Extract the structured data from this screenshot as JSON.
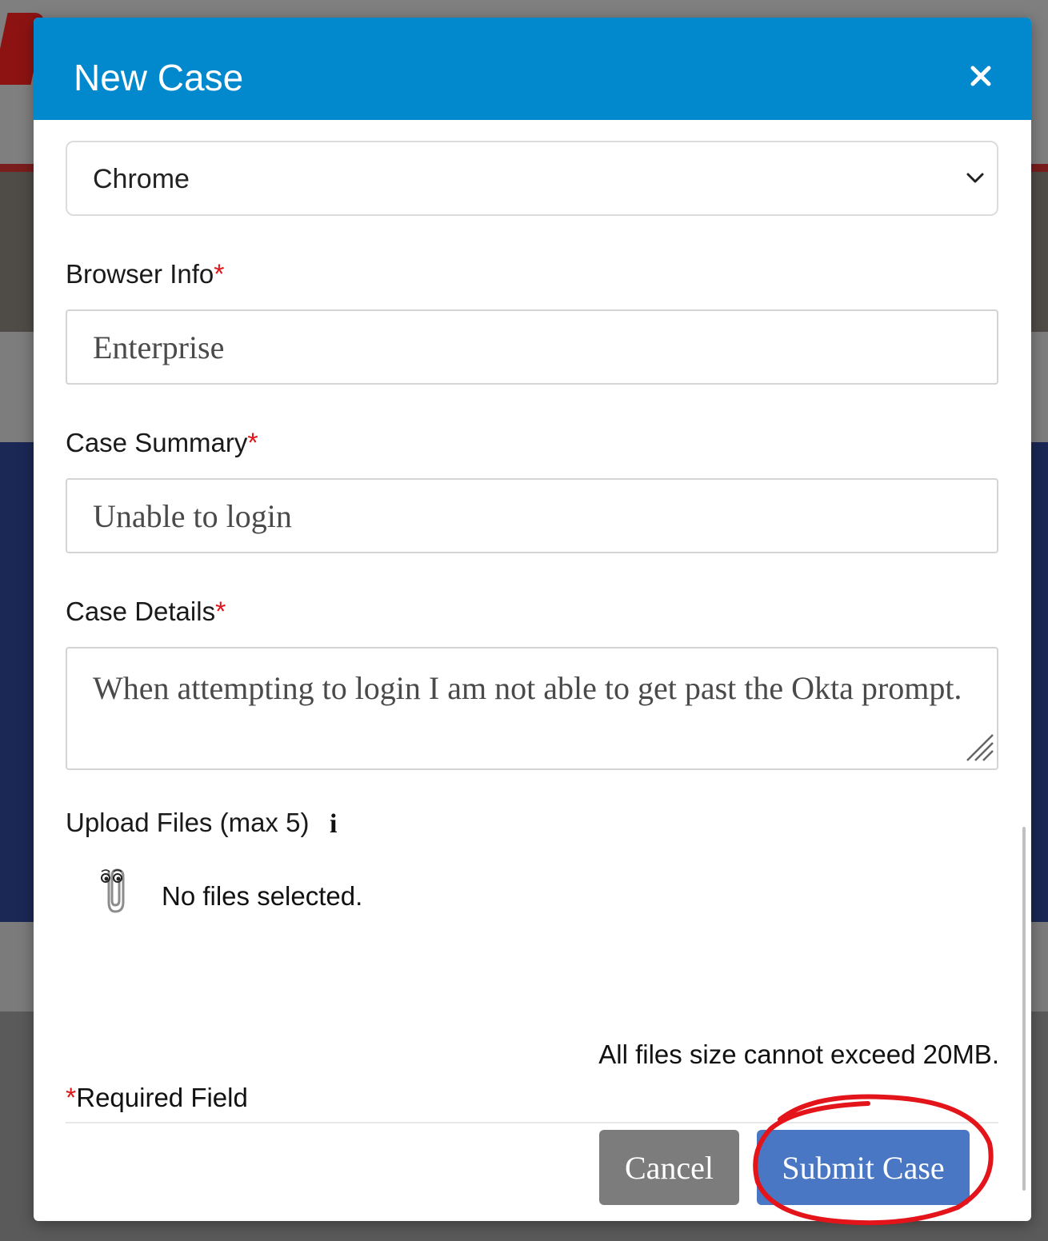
{
  "modal": {
    "title": "New Case",
    "close_icon": "close-icon"
  },
  "form": {
    "browser_select": {
      "value": "Chrome",
      "icon": "chevron-down-icon"
    },
    "browser_info": {
      "label": "Browser Info",
      "required_mark": "*",
      "value": "Enterprise"
    },
    "case_summary": {
      "label": "Case Summary",
      "required_mark": "*",
      "value": "Unable to login"
    },
    "case_details": {
      "label": "Case Details",
      "required_mark": "*",
      "value": "When attempting to login I am not able to get past the Okta prompt."
    },
    "upload": {
      "label": "Upload Files (max 5)",
      "info_icon": "info-icon",
      "attach_icon": "paperclip-icon",
      "status": "No files selected.",
      "size_note": "All files size cannot exceed 20MB."
    },
    "required_note": {
      "mark": "*",
      "text": "Required Field"
    }
  },
  "footer": {
    "cancel_label": "Cancel",
    "submit_label": "Submit Case"
  },
  "colors": {
    "header": "#0288cc",
    "submit": "#4a77c4",
    "cancel": "#7c7c7c",
    "required": "#e0161b",
    "annotation_circle": "#e3141a"
  }
}
